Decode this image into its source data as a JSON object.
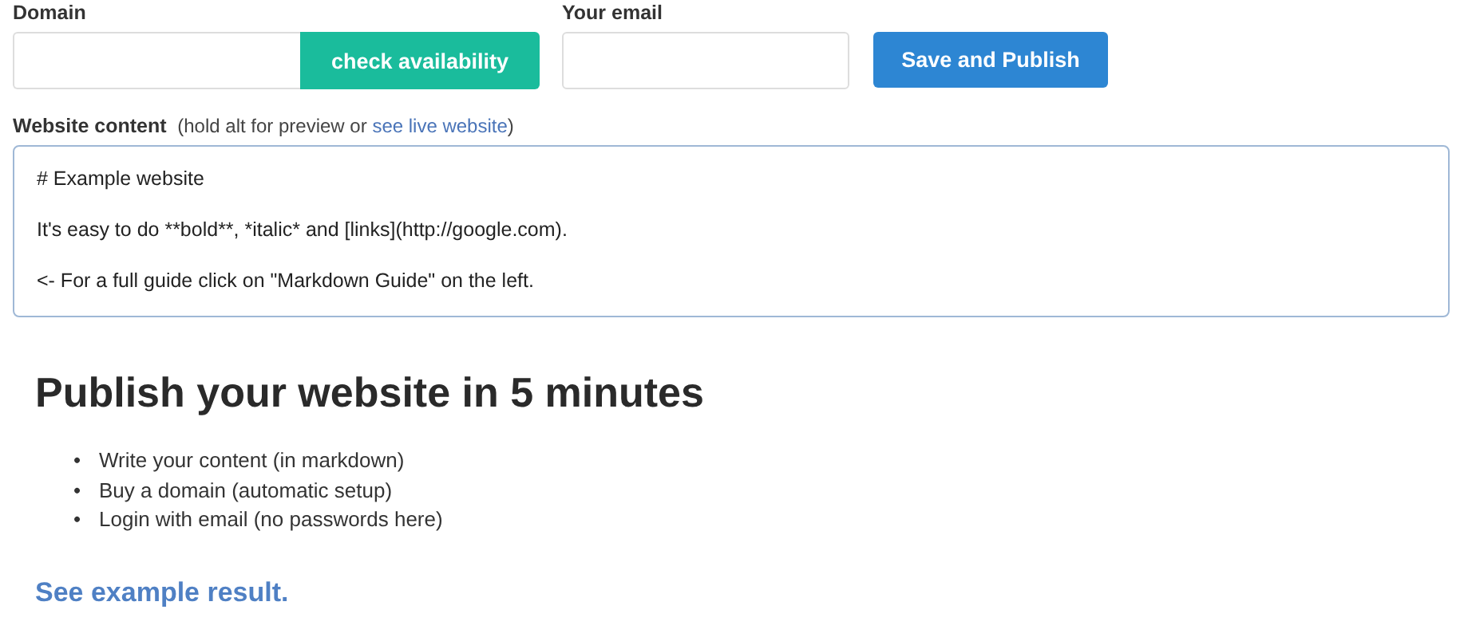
{
  "domain_field": {
    "label": "Domain",
    "button": "check availability"
  },
  "email_field": {
    "label": "Your email"
  },
  "publish_button": "Save and Publish",
  "content_editor": {
    "label": "Website content",
    "hint": "(hold alt for preview or ",
    "link": "see live website",
    "hint_end": ")",
    "lines": [
      "# Example website",
      "It's easy to do **bold**, *italic* and [links](http://google.com).",
      "<- For a full guide click on \"Markdown Guide\" on the left."
    ]
  },
  "intro": {
    "heading": "Publish your website in 5 minutes",
    "bullets": [
      {
        "marker": "•",
        "text": "Write your content (in markdown)"
      },
      {
        "marker": "•",
        "text": "Buy a domain (automatic setup)"
      },
      {
        "marker": "•",
        "text": "Login with email (no passwords here)"
      }
    ],
    "link": "See example result."
  }
}
